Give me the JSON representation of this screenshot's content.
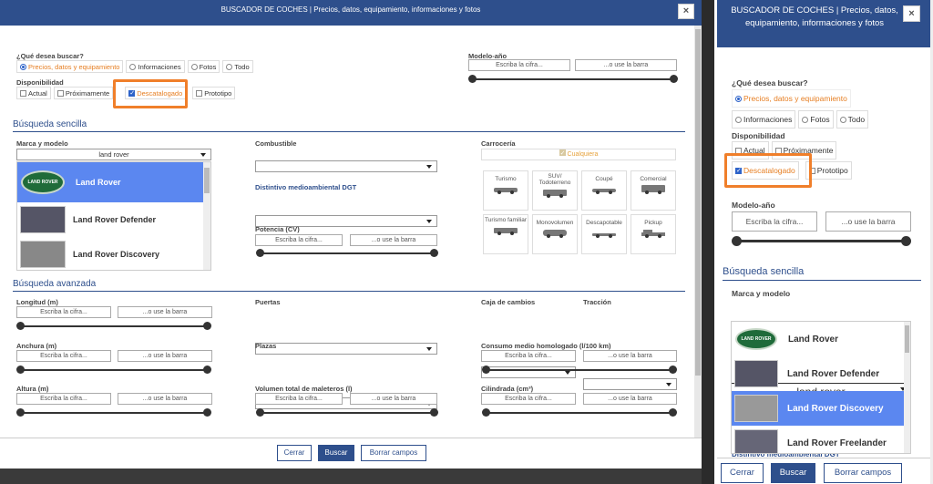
{
  "left": {
    "title": "BUSCADOR DE COCHES | Precios, datos, equipamiento, informaciones y fotos",
    "close": "×",
    "que_label": "¿Qué desea buscar?",
    "que_options": [
      "Precios, datos y equipamiento",
      "Informaciones",
      "Fotos",
      "Todo"
    ],
    "disp_label": "Disponibilidad",
    "disp_options": [
      "Actual",
      "Próximamente",
      "Descatalogado",
      "Prototipo"
    ],
    "modelo_label": "Modelo-año",
    "cifra": "Escriba la cifra...",
    "barra": "...o use la barra",
    "busqueda_sencilla": "Búsqueda sencilla",
    "marca_label": "Marca y modelo",
    "marca_value": "land rover",
    "marcas": [
      "Land Rover",
      "Land Rover Defender",
      "Land Rover Discovery"
    ],
    "combustible": "Combustible",
    "distintivo": "Distintivo medioambiental DGT",
    "potencia": "Potencia (CV)",
    "carroceria": "Carrocería",
    "cualquiera": "Cualquiera",
    "cars": [
      "Turismo",
      "SUV/ Todoterreno",
      "Coupé",
      "Comercial",
      "Turismo familiar",
      "Monovolumen",
      "Descapotable",
      "Pickup"
    ],
    "busqueda_avanzada": "Búsqueda avanzada",
    "longitud": "Longitud (m)",
    "anchura": "Anchura (m)",
    "altura": "Altura (m)",
    "puertas": "Puertas",
    "plazas": "Plazas",
    "volumen": "Volumen total de maleteros (l)",
    "caja": "Caja de cambios",
    "traccion": "Tracción",
    "consumo": "Consumo medio homologado (l/100 km)",
    "cilindrada": "Cilindrada (cm³)",
    "cerrar": "Cerrar",
    "buscar": "Buscar",
    "borrar": "Borrar campos"
  },
  "right": {
    "title": "BUSCADOR DE COCHES | Precios, datos, equipamiento, informaciones y fotos",
    "close": "×",
    "que_label": "¿Qué desea buscar?",
    "que_options": [
      "Precios, datos y equipamiento",
      "Informaciones",
      "Fotos",
      "Todo"
    ],
    "disp_label": "Disponibilidad",
    "disp_options": [
      "Actual",
      "Próximamente",
      "Descatalogado",
      "Prototipo"
    ],
    "modelo_label": "Modelo-año",
    "cifra": "Escriba la cifra...",
    "barra": "...o use la barra",
    "busqueda_sencilla": "Búsqueda sencilla",
    "marca_label": "Marca y modelo",
    "marca_value": "land rover",
    "marcas": [
      "Land Rover",
      "Land Rover Defender",
      "Land Rover Discovery",
      "Land Rover Freelander"
    ],
    "distintivo": "Distintivo medioambiental DGT",
    "cerrar": "Cerrar",
    "buscar": "Buscar",
    "borrar": "Borrar campos"
  },
  "logo_text": "LAND ROVER",
  "colors": {
    "header": "#2e4f8c",
    "highlight": "#f07f2a",
    "selected": "#5b87f0",
    "orange_text": "#e67e22"
  }
}
